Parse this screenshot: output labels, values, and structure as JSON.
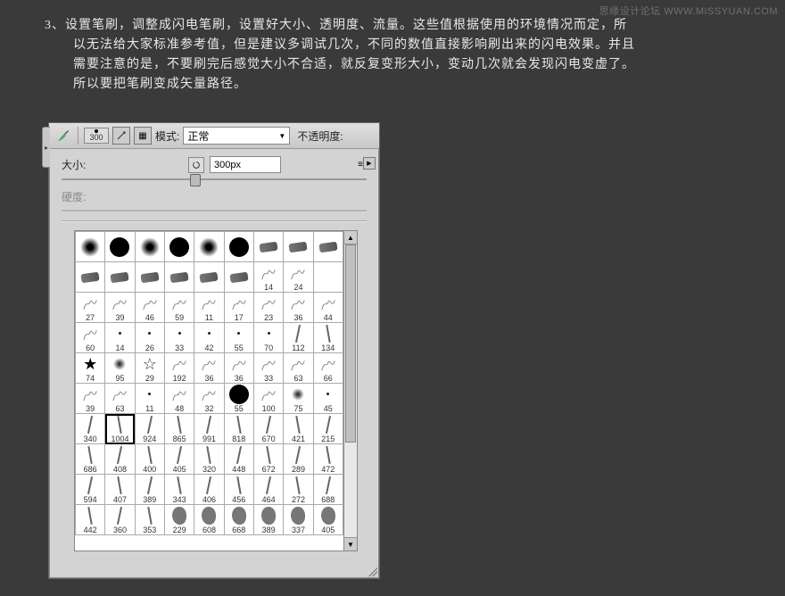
{
  "watermark": "思缘设计论坛  WWW.MISSYUAN.COM",
  "instruction": {
    "step": "3、",
    "line1": "设置笔刷，调整成闪电笔刷，设置好大小、透明度、流量。这些值根据使用的环境情况而定，所",
    "line2": "以无法给大家标准参考值，但是建议多调试几次，不同的数值直接影响刷出来的闪电效果。并且",
    "line3": "需要注意的是，不要刷完后感觉大小不合适，就反复变形大小，变动几次就会发现闪电变虚了。",
    "line4": "所以要把笔刷变成矢量路径。"
  },
  "toolbar": {
    "brush_size_hint": "300",
    "mode_label": "模式:",
    "mode_value": "正常",
    "opacity_label": "不透明度:"
  },
  "settings": {
    "size_label": "大小:",
    "size_value": "300px",
    "hardness_label": "硬度:"
  },
  "brush_rows": [
    [
      {
        "t": "soft"
      },
      {
        "t": "hard"
      },
      {
        "t": "soft"
      },
      {
        "t": "hard"
      },
      {
        "t": "soft"
      },
      {
        "t": "hard"
      },
      {
        "t": "chalk"
      },
      {
        "t": "chalk"
      },
      {
        "t": "chalk"
      }
    ],
    [
      {
        "t": "chalk"
      },
      {
        "t": "chalk"
      },
      {
        "t": "chalk"
      },
      {
        "t": "chalk"
      },
      {
        "t": "chalk"
      },
      {
        "t": "chalk"
      },
      {
        "t": "scr",
        "n": "14"
      },
      {
        "t": "scr",
        "n": "24"
      },
      {
        "t": ""
      }
    ],
    [
      {
        "t": "scr",
        "n": "27"
      },
      {
        "t": "scr",
        "n": "39"
      },
      {
        "t": "scr",
        "n": "46"
      },
      {
        "t": "scr",
        "n": "59"
      },
      {
        "t": "scr",
        "n": "11"
      },
      {
        "t": "scr",
        "n": "17"
      },
      {
        "t": "scr",
        "n": "23"
      },
      {
        "t": "scr",
        "n": "36"
      },
      {
        "t": "scr",
        "n": "44"
      }
    ],
    [
      {
        "t": "scr",
        "n": "60"
      },
      {
        "t": "dot",
        "n": "14"
      },
      {
        "t": "dot",
        "n": "26"
      },
      {
        "t": "dot",
        "n": "33"
      },
      {
        "t": "dot",
        "n": "42"
      },
      {
        "t": "dot",
        "n": "55"
      },
      {
        "t": "dot",
        "n": "70"
      },
      {
        "t": "strand",
        "n": "112"
      },
      {
        "t": "strand2",
        "n": "134"
      }
    ],
    [
      {
        "t": "star",
        "n": "74"
      },
      {
        "t": "tsoft",
        "n": "95"
      },
      {
        "t": "staro",
        "n": "29"
      },
      {
        "t": "scr",
        "n": "192"
      },
      {
        "t": "scr",
        "n": "36"
      },
      {
        "t": "scr",
        "n": "36"
      },
      {
        "t": "scr",
        "n": "33"
      },
      {
        "t": "scr",
        "n": "63"
      },
      {
        "t": "scr",
        "n": "66"
      }
    ],
    [
      {
        "t": "scr",
        "n": "39"
      },
      {
        "t": "scr",
        "n": "63"
      },
      {
        "t": "dot",
        "n": "11"
      },
      {
        "t": "scr",
        "n": "48"
      },
      {
        "t": "scr",
        "n": "32"
      },
      {
        "t": "hard",
        "n": "55"
      },
      {
        "t": "scr",
        "n": "100"
      },
      {
        "t": "tsoft",
        "n": "75"
      },
      {
        "t": "dot",
        "n": "45"
      }
    ],
    [
      {
        "t": "strand",
        "n": "340"
      },
      {
        "t": "strand2",
        "n": "1004",
        "sel": true
      },
      {
        "t": "strand",
        "n": "924"
      },
      {
        "t": "strand2",
        "n": "865"
      },
      {
        "t": "strand",
        "n": "991"
      },
      {
        "t": "strand2",
        "n": "818"
      },
      {
        "t": "strand",
        "n": "670"
      },
      {
        "t": "strand2",
        "n": "421"
      },
      {
        "t": "strand",
        "n": "215"
      }
    ],
    [
      {
        "t": "strand2",
        "n": "686"
      },
      {
        "t": "strand",
        "n": "408"
      },
      {
        "t": "strand2",
        "n": "400"
      },
      {
        "t": "strand",
        "n": "405"
      },
      {
        "t": "strand2",
        "n": "320"
      },
      {
        "t": "strand",
        "n": "448"
      },
      {
        "t": "strand2",
        "n": "672"
      },
      {
        "t": "strand",
        "n": "289"
      },
      {
        "t": "strand2",
        "n": "472"
      }
    ],
    [
      {
        "t": "strand",
        "n": "594"
      },
      {
        "t": "strand2",
        "n": "407"
      },
      {
        "t": "strand",
        "n": "389"
      },
      {
        "t": "strand2",
        "n": "343"
      },
      {
        "t": "strand",
        "n": "406"
      },
      {
        "t": "strand2",
        "n": "456"
      },
      {
        "t": "strand",
        "n": "464"
      },
      {
        "t": "strand2",
        "n": "272"
      },
      {
        "t": "strand",
        "n": "688"
      }
    ],
    [
      {
        "t": "strand2",
        "n": "442"
      },
      {
        "t": "strand",
        "n": "360"
      },
      {
        "t": "strand2",
        "n": "353"
      },
      {
        "t": "blob",
        "n": "229"
      },
      {
        "t": "blob",
        "n": "608"
      },
      {
        "t": "blob",
        "n": "668"
      },
      {
        "t": "blob",
        "n": "389"
      },
      {
        "t": "blob",
        "n": "337"
      },
      {
        "t": "blob",
        "n": "405"
      }
    ]
  ]
}
